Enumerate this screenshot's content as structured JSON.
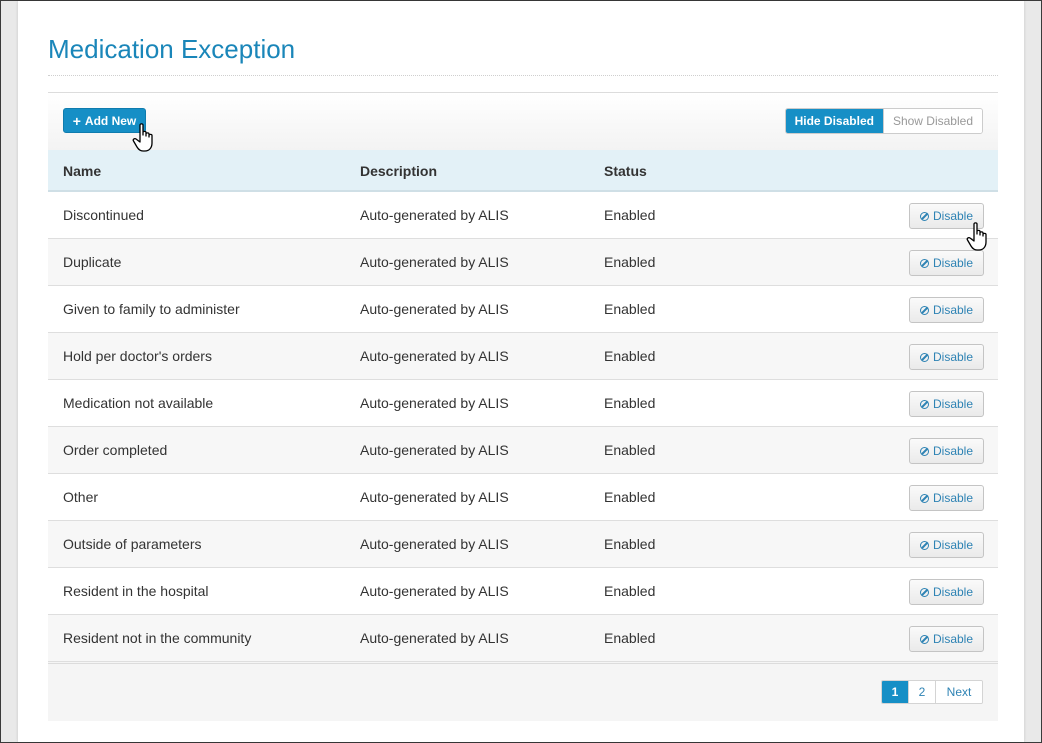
{
  "page_title": "Medication Exception",
  "toolbar": {
    "add_new_label": "Add New",
    "hide_disabled_label": "Hide Disabled",
    "show_disabled_label": "Show Disabled"
  },
  "table": {
    "headers": {
      "name": "Name",
      "description": "Description",
      "status": "Status"
    },
    "rows": [
      {
        "name": "Discontinued",
        "description": "Auto-generated by ALIS",
        "status": "Enabled",
        "action": "Disable"
      },
      {
        "name": "Duplicate",
        "description": "Auto-generated by ALIS",
        "status": "Enabled",
        "action": "Disable"
      },
      {
        "name": "Given to family to administer",
        "description": "Auto-generated by ALIS",
        "status": "Enabled",
        "action": "Disable"
      },
      {
        "name": "Hold per doctor's orders",
        "description": "Auto-generated by ALIS",
        "status": "Enabled",
        "action": "Disable"
      },
      {
        "name": "Medication not available",
        "description": "Auto-generated by ALIS",
        "status": "Enabled",
        "action": "Disable"
      },
      {
        "name": "Order completed",
        "description": "Auto-generated by ALIS",
        "status": "Enabled",
        "action": "Disable"
      },
      {
        "name": "Other",
        "description": "Auto-generated by ALIS",
        "status": "Enabled",
        "action": "Disable"
      },
      {
        "name": "Outside of parameters",
        "description": "Auto-generated by ALIS",
        "status": "Enabled",
        "action": "Disable"
      },
      {
        "name": "Resident in the hospital",
        "description": "Auto-generated by ALIS",
        "status": "Enabled",
        "action": "Disable"
      },
      {
        "name": "Resident not in the community",
        "description": "Auto-generated by ALIS",
        "status": "Enabled",
        "action": "Disable"
      }
    ]
  },
  "pagination": {
    "page_1": "1",
    "page_2": "2",
    "next_label": "Next"
  },
  "colors": {
    "accent": "#168fc6",
    "title": "#1a86b9",
    "header_bg": "#e3f1f7"
  },
  "icons": {
    "add": "plus-icon",
    "disable": "ban-icon",
    "cursor": "hand-pointer-icon"
  }
}
